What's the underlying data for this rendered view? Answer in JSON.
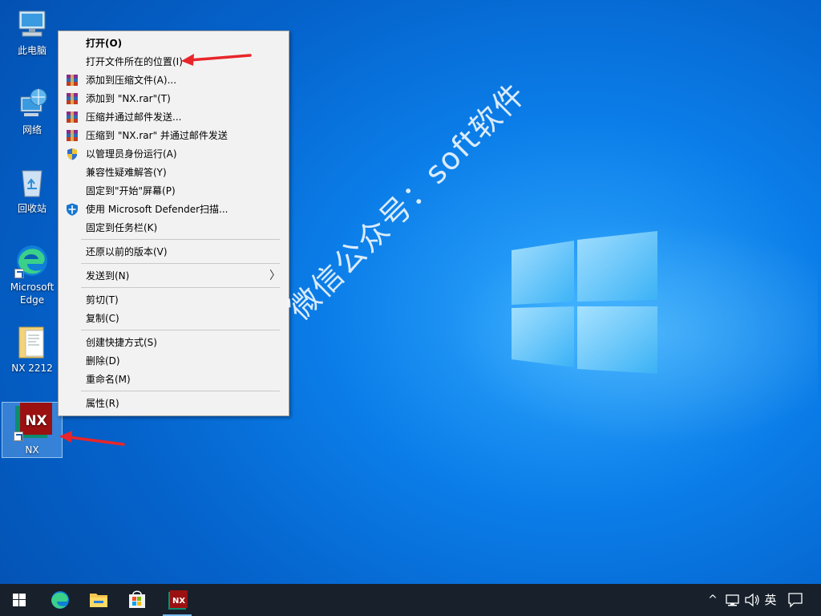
{
  "desktop": {
    "icons": [
      {
        "label": "此电脑",
        "icon": "computer-icon"
      },
      {
        "label": "网络",
        "icon": "network-icon"
      },
      {
        "label": "回收站",
        "icon": "recycle-bin-icon"
      },
      {
        "label": "Microsoft Edge",
        "icon": "edge-icon"
      },
      {
        "label": "NX 2212",
        "icon": "folder-icon"
      },
      {
        "label": "NX",
        "icon": "nx-icon"
      }
    ]
  },
  "context_menu": {
    "items": [
      {
        "label": "打开(O)",
        "icon": null
      },
      {
        "label": "打开文件所在的位置(I)",
        "icon": null
      },
      {
        "label": "添加到压缩文件(A)...",
        "icon": "winrar-icon"
      },
      {
        "label": "添加到 \"NX.rar\"(T)",
        "icon": "winrar-icon"
      },
      {
        "label": "压缩并通过邮件发送...",
        "icon": "winrar-icon"
      },
      {
        "label": "压缩到 \"NX.rar\" 并通过邮件发送",
        "icon": "winrar-icon"
      },
      {
        "label": "以管理员身份运行(A)",
        "icon": "uac-shield-icon"
      },
      {
        "label": "兼容性疑难解答(Y)",
        "icon": null
      },
      {
        "label": "固定到\"开始\"屏幕(P)",
        "icon": null
      },
      {
        "label": "使用 Microsoft Defender扫描...",
        "icon": "defender-icon"
      },
      {
        "label": "固定到任务栏(K)",
        "icon": null
      },
      {
        "label": "还原以前的版本(V)",
        "icon": null
      },
      {
        "label": "发送到(N)",
        "icon": null,
        "submenu": "〉"
      },
      {
        "label": "剪切(T)",
        "icon": null
      },
      {
        "label": "复制(C)",
        "icon": null
      },
      {
        "label": "创建快捷方式(S)",
        "icon": null
      },
      {
        "label": "删除(D)",
        "icon": null
      },
      {
        "label": "重命名(M)",
        "icon": null
      },
      {
        "label": "属性(R)",
        "icon": null
      }
    ]
  },
  "watermark": "微信公众号：soft软件",
  "taskbar": {
    "apps": [
      "start-icon",
      "edge-icon",
      "file-explorer-icon",
      "store-icon",
      "nx-icon"
    ],
    "tray": {
      "chevron": "^",
      "network": "network-icon",
      "volume": "volume-icon",
      "ime": "英",
      "notifications": "notification-icon"
    }
  },
  "colors": {
    "accent_arrow": "#e8252a",
    "taskbar": "#17202b",
    "nx_red": "#9b1111"
  }
}
